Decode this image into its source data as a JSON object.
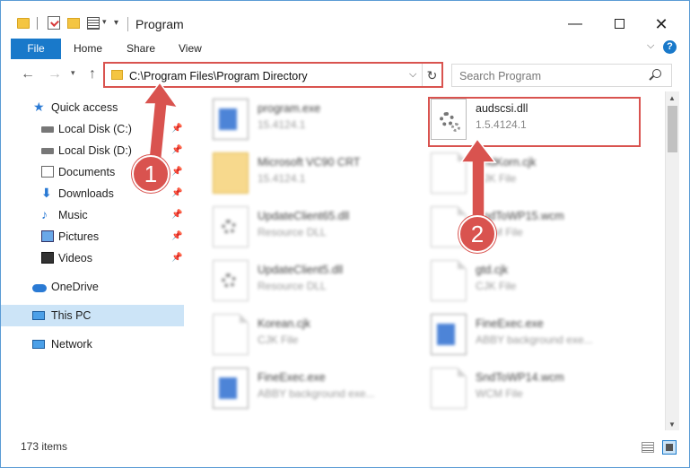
{
  "window": {
    "title": "Program",
    "minimize_glyph": "—",
    "close_glyph": "✕"
  },
  "ribbon": {
    "tabs": [
      "File",
      "Home",
      "Share",
      "View"
    ],
    "help": "?"
  },
  "address": {
    "path": "C:\\Program Files\\Program Directory",
    "refresh_glyph": "↻"
  },
  "search": {
    "placeholder": "Search Program"
  },
  "sidebar": {
    "items": [
      {
        "label": "Quick access",
        "icon": "star-icon",
        "pinned": false
      },
      {
        "label": "Local Disk (C:)",
        "icon": "disk-icon",
        "pinned": true
      },
      {
        "label": "Local Disk (D:)",
        "icon": "disk-icon",
        "pinned": true
      },
      {
        "label": "Documents",
        "icon": "documents-icon",
        "pinned": true
      },
      {
        "label": "Downloads",
        "icon": "download-icon",
        "pinned": true
      },
      {
        "label": "Music",
        "icon": "music-icon",
        "pinned": true
      },
      {
        "label": "Pictures",
        "icon": "pictures-icon",
        "pinned": true
      },
      {
        "label": "Videos",
        "icon": "videos-icon",
        "pinned": true
      },
      {
        "label": "OneDrive",
        "icon": "cloud-icon",
        "pinned": false
      },
      {
        "label": "This PC",
        "icon": "computer-icon",
        "pinned": false,
        "selected": true
      },
      {
        "label": "Network",
        "icon": "network-icon",
        "pinned": false
      }
    ]
  },
  "files": [
    {
      "name": "program.exe",
      "sub": "15.4124.1",
      "icon": "program-exe-icon"
    },
    {
      "name": "audscsi.dll",
      "sub": "1.5.4124.1",
      "icon": "dll-gear-icon"
    },
    {
      "name": "Microsoft VC90 CRT",
      "sub": "15.4124.1",
      "icon": "folder-icon"
    },
    {
      "name": "SndKorn.cjk",
      "sub": "CJK File",
      "icon": "document-icon"
    },
    {
      "name": "UpdateClient65.dll",
      "sub": "Resource DLL",
      "icon": "dll-gear-icon"
    },
    {
      "name": "SndToWP15.wcm",
      "sub": "WCM File",
      "icon": "document-icon"
    },
    {
      "name": "UpdateClient5.dll",
      "sub": "Resource DLL",
      "icon": "dll-gear-icon"
    },
    {
      "name": "gtd.cjk",
      "sub": "CJK File",
      "icon": "document-icon"
    },
    {
      "name": "Korean.cjk",
      "sub": "CJK File",
      "icon": "document-icon"
    },
    {
      "name": "FineExec.exe",
      "sub": "ABBY background exe...",
      "icon": "exe-icon"
    },
    {
      "name": "FineExec.exe",
      "sub": "ABBY background exe...",
      "icon": "exe-icon"
    },
    {
      "name": "SndToWP14.wcm",
      "sub": "WCM File",
      "icon": "document-icon"
    }
  ],
  "status": {
    "count": "173 items"
  },
  "annotations": {
    "step1": "1",
    "step2": "2",
    "color": "#d9534f"
  },
  "colors": {
    "accent": "#1979ca",
    "selection": "#cce4f7",
    "window_border": "#5a9bd5"
  }
}
